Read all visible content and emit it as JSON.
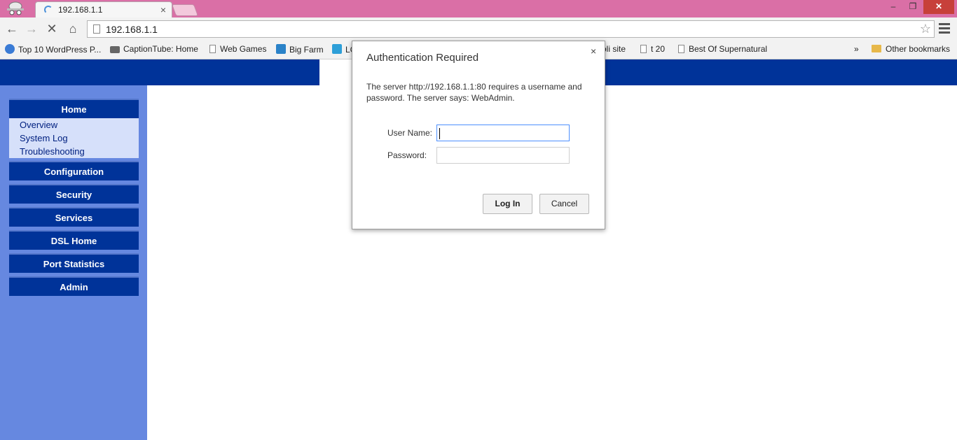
{
  "browser": {
    "tab_title": "192.168.1.1",
    "tab_close": "×",
    "url": "192.168.1.1",
    "window_controls": {
      "minimize": "–",
      "maximize": "❐",
      "close": "✕"
    },
    "nav": {
      "back": "←",
      "forward": "→",
      "stop": "✕",
      "home": "⌂",
      "star": "☆"
    }
  },
  "bookmarks": {
    "items": [
      {
        "label": "Top 10 WordPress P...",
        "icon": "globe-icon"
      },
      {
        "label": "CaptionTube: Home",
        "icon": "keyboard-icon"
      },
      {
        "label": "Web Games",
        "icon": "page-icon"
      },
      {
        "label": "Big Farm",
        "icon": "bigfarm-icon"
      },
      {
        "label": "LC",
        "icon": "lc-icon"
      },
      {
        "label": "oli site",
        "icon": "page-icon"
      },
      {
        "label": "t 20",
        "icon": "page-icon"
      },
      {
        "label": "Best Of Supernatural",
        "icon": "page-icon"
      }
    ],
    "overflow": "»",
    "other": "Other bookmarks"
  },
  "router": {
    "menu": [
      {
        "label": "Home"
      },
      {
        "label": "Configuration"
      },
      {
        "label": "Security"
      },
      {
        "label": "Services"
      },
      {
        "label": "DSL Home"
      },
      {
        "label": "Port Statistics"
      },
      {
        "label": "Admin"
      }
    ],
    "submenu": [
      "Overview",
      "System Log",
      "Troubleshooting"
    ]
  },
  "dialog": {
    "title": "Authentication Required",
    "close": "×",
    "message": "The server http://192.168.1.1:80 requires a username and password. The server says: WebAdmin.",
    "username_label": "User Name:",
    "password_label": "Password:",
    "username_value": "",
    "password_value": "",
    "login_label": "Log In",
    "cancel_label": "Cancel"
  }
}
